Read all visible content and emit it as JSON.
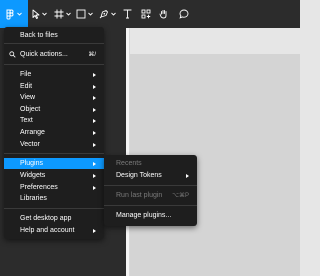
{
  "toolbar": {
    "tools": [
      {
        "name": "main-menu-button",
        "icon": "figma-logo-icon"
      },
      {
        "name": "move-tool",
        "icon": "cursor-icon"
      },
      {
        "name": "frame-tool",
        "icon": "frame-icon"
      },
      {
        "name": "shape-tool",
        "icon": "rectangle-icon"
      },
      {
        "name": "pen-tool",
        "icon": "pen-icon"
      },
      {
        "name": "text-tool",
        "icon": "text-icon"
      },
      {
        "name": "resources-tool",
        "icon": "components-icon"
      },
      {
        "name": "hand-tool",
        "icon": "hand-icon"
      },
      {
        "name": "comment-tool",
        "icon": "comment-icon"
      }
    ],
    "accent": "#0d99ff"
  },
  "main_menu": {
    "back": "Back to files",
    "quick_actions": "Quick actions...",
    "quick_actions_shortcut": "⌘/",
    "file": "File",
    "edit": "Edit",
    "view": "View",
    "object": "Object",
    "text": "Text",
    "arrange": "Arrange",
    "vector": "Vector",
    "plugins": "Plugins",
    "widgets": "Widgets",
    "preferences": "Preferences",
    "libraries": "Libraries",
    "desktop_app": "Get desktop app",
    "help": "Help and account"
  },
  "plugins_menu": {
    "recents": "Recents",
    "design_tokens": "Design Tokens",
    "run_last": "Run last plugin",
    "run_last_shortcut": "⌥⌘P",
    "manage": "Manage plugins..."
  }
}
